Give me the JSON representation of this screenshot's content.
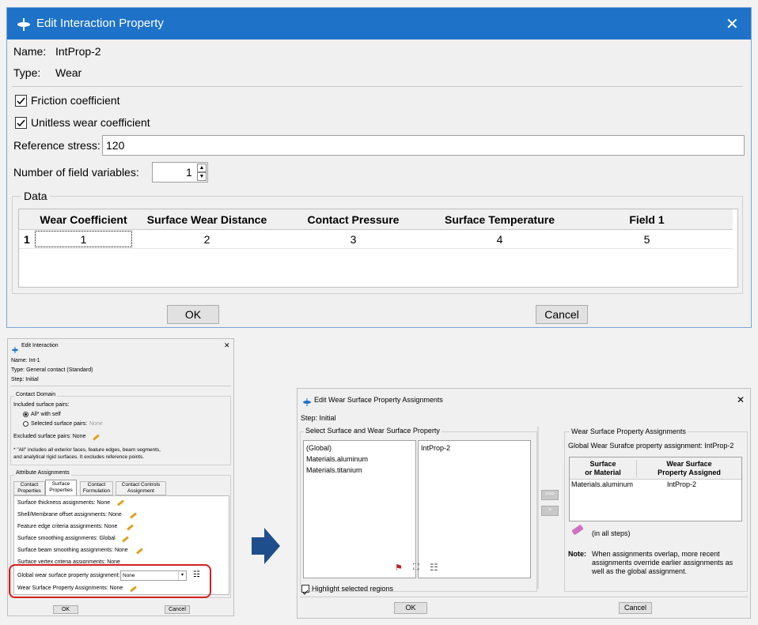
{
  "dialog1": {
    "title": "Edit Interaction Property",
    "name_label": "Name:",
    "name_value": "IntProp-2",
    "type_label": "Type:",
    "type_value": "Wear",
    "friction_label": "Friction coefficient",
    "unitless_label": "Unitless wear coefficient",
    "ref_stress_label": "Reference stress:",
    "ref_stress_value": "120",
    "num_fields_label": "Number of field variables:",
    "num_fields_value": "1",
    "data_group": "Data",
    "table_headers": [
      "Wear Coefficient",
      "Surface Wear Distance",
      "Contact Pressure",
      "Surface Temperature",
      "Field 1"
    ],
    "row_number": "1",
    "row_values": [
      "1",
      "2",
      "3",
      "4",
      "5"
    ],
    "ok": "OK",
    "cancel": "Cancel"
  },
  "dialog2": {
    "title": "Edit Interaction",
    "name": "Name:  Int-1",
    "type": "Type:   General contact (Standard)",
    "step": "Step:   Initial",
    "contact_domain": "Contact Domain",
    "included_pairs": "Included surface pairs:",
    "all_with_self": "All* with self",
    "selected_pairs": "Selected surface pairs:",
    "selected_pairs_value": "None",
    "excluded_pairs": "Excluded surface pairs:  None",
    "note_line1": "* \"All\" includes all exterior faces, feature edges, beam segments,",
    "note_line2": "and analytical rigid surfaces. It excludes reference points.",
    "attribute_assignments": "Attribute Assignments",
    "tabs": [
      "Contact\nProperties",
      "Surface\nProperties",
      "Contact\nFormulation",
      "Contact Controls\nAssignment"
    ],
    "rows": [
      "Surface thickness assignments:  None",
      "Shell/Membrane offset assignments:  None",
      "Feature edge criteria assignments:  None",
      "Surface smoothing assignments:  Global",
      "Surface beam smoothing assignments:  None",
      "Surface vertex criteria assignments:  None"
    ],
    "global_wear_label": "Global wear surface property assignment:",
    "global_wear_value": "None",
    "wear_assignments": "Wear Surface Property Assignments:  None",
    "ok": "OK",
    "cancel": "Cancel"
  },
  "dialog3": {
    "title": "Edit Wear Surface Property Assignments",
    "step": "Step:  Initial",
    "select_group": "Select Surface and Wear Surface Property",
    "surfaces": [
      "(Global)",
      "Materials.aluminum",
      "Materials.titanium"
    ],
    "properties": [
      "IntProp-2"
    ],
    "assign_group": "Wear Surface Property Assignments",
    "global_assignment": "Global Wear Surafce property assignment:  IntProp-2",
    "col1": "Surface\nor Material",
    "col2": "Wear Surface\nProperty Assigned",
    "row_surface": "Materials.aluminum",
    "row_property": "IntProp-2",
    "in_all_steps": "(in all steps)",
    "note_label": "Note:",
    "note_text": "When assignments overlap, more recent assignments override earlier assignments as well as the global assignment.",
    "highlight": "Highlight selected regions",
    "ok": "OK",
    "cancel": "Cancel"
  },
  "colors": {
    "titlebar": "#1e73c8",
    "highlight_box": "#d42020",
    "arrow": "#1f4e8c"
  }
}
